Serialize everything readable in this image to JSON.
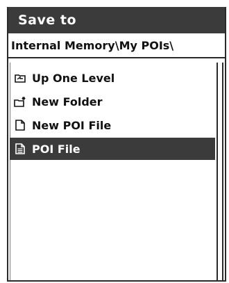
{
  "dialog": {
    "title": "Save to",
    "path": "Internal Memory\\My POIs\\"
  },
  "list": {
    "items": [
      {
        "label": "Up One Level",
        "icon": "up-folder-icon",
        "selected": false
      },
      {
        "label": "New Folder",
        "icon": "new-folder-icon",
        "selected": false
      },
      {
        "label": "New POI File",
        "icon": "new-file-icon",
        "selected": false
      },
      {
        "label": "POI File",
        "icon": "poi-file-icon",
        "selected": true
      }
    ]
  },
  "colors": {
    "title_bar": "#3b3b3b",
    "selection": "#3b3b3b",
    "text": "#111111"
  }
}
